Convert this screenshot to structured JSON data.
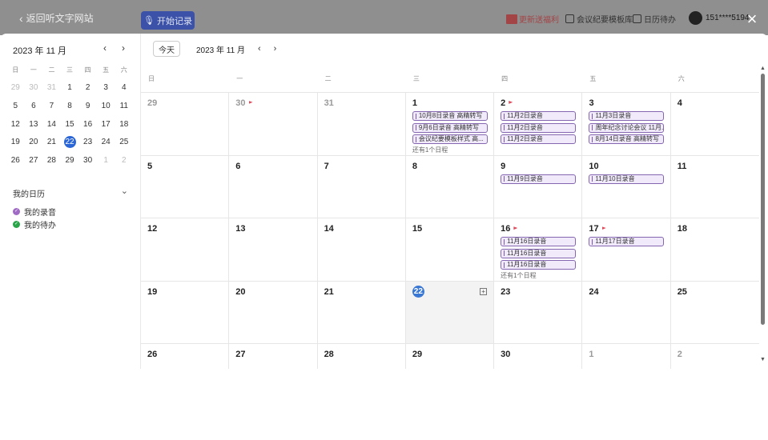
{
  "topbar": {
    "back_label": "返回听文字网站",
    "record_label": "开始记录",
    "gift_label": "更新送福利",
    "template_label": "会议纪要模板库",
    "calendar_label": "日历待办",
    "user_label": "151****5194"
  },
  "mini_calendar": {
    "title": "2023 年 11 月",
    "prev": "‹",
    "next": "›",
    "weekdays": [
      "日",
      "一",
      "二",
      "三",
      "四",
      "五",
      "六"
    ],
    "rows": [
      [
        "29",
        "30",
        "31",
        "1",
        "2",
        "3",
        "4"
      ],
      [
        "5",
        "6",
        "7",
        "8",
        "9",
        "10",
        "11"
      ],
      [
        "12",
        "13",
        "14",
        "15",
        "16",
        "17",
        "18"
      ],
      [
        "19",
        "20",
        "21",
        "22",
        "23",
        "24",
        "25"
      ],
      [
        "26",
        "27",
        "28",
        "29",
        "30",
        "1",
        "2"
      ]
    ]
  },
  "my_calendars": {
    "title": "我的日历",
    "items": [
      {
        "label": "我的录音",
        "color": "#a06bc4"
      },
      {
        "label": "我的待办",
        "color": "#2aa54a"
      }
    ]
  },
  "toolbar": {
    "today_label": "今天",
    "month_label": "2023 年 11 月",
    "prev": "‹",
    "next": "›"
  },
  "weekdays": [
    "日",
    "一",
    "二",
    "三",
    "四",
    "五",
    "六"
  ],
  "weeks": [
    [
      {
        "n": "29",
        "other": true
      },
      {
        "n": "30",
        "other": true,
        "flag": true
      },
      {
        "n": "31",
        "other": true
      },
      {
        "n": "1",
        "events": [
          "10月8日录音 高精转写",
          "9月6日录音 高精转写",
          "会议纪要模板样式 高..."
        ],
        "more": "还有1个日程"
      },
      {
        "n": "2",
        "flag": true,
        "events": [
          "11月2日录音",
          "11月2日录音",
          "11月2日录音"
        ]
      },
      {
        "n": "3",
        "events": [
          "11月3日录音",
          "周年纪念讨论会议 11月...",
          "8月14日录音 高精转写"
        ]
      },
      {
        "n": "4"
      }
    ],
    [
      {
        "n": "5"
      },
      {
        "n": "6"
      },
      {
        "n": "7"
      },
      {
        "n": "8"
      },
      {
        "n": "9",
        "events": [
          "11月9日录音"
        ]
      },
      {
        "n": "10",
        "events": [
          "11月10日录音"
        ]
      },
      {
        "n": "11"
      }
    ],
    [
      {
        "n": "12"
      },
      {
        "n": "13"
      },
      {
        "n": "14"
      },
      {
        "n": "15"
      },
      {
        "n": "16",
        "flag": true,
        "events": [
          "11月16日录音",
          "11月16日录音",
          "11月16日录音"
        ],
        "more": "还有1个日程"
      },
      {
        "n": "17",
        "flag": true,
        "events": [
          "11月17日录音"
        ]
      },
      {
        "n": "18"
      }
    ],
    [
      {
        "n": "19"
      },
      {
        "n": "20"
      },
      {
        "n": "21"
      },
      {
        "n": "22",
        "today": true,
        "plus": "+"
      },
      {
        "n": "23"
      },
      {
        "n": "24"
      },
      {
        "n": "25"
      }
    ],
    [
      {
        "n": "26"
      },
      {
        "n": "27"
      },
      {
        "n": "28"
      },
      {
        "n": "29"
      },
      {
        "n": "30"
      },
      {
        "n": "1",
        "other": true
      },
      {
        "n": "2",
        "other": true
      }
    ]
  ],
  "colors": {
    "accent": "#2b66d6",
    "event_border": "#8465b0",
    "event_bg": "#f1eafb",
    "flag": "#e04b5c"
  }
}
